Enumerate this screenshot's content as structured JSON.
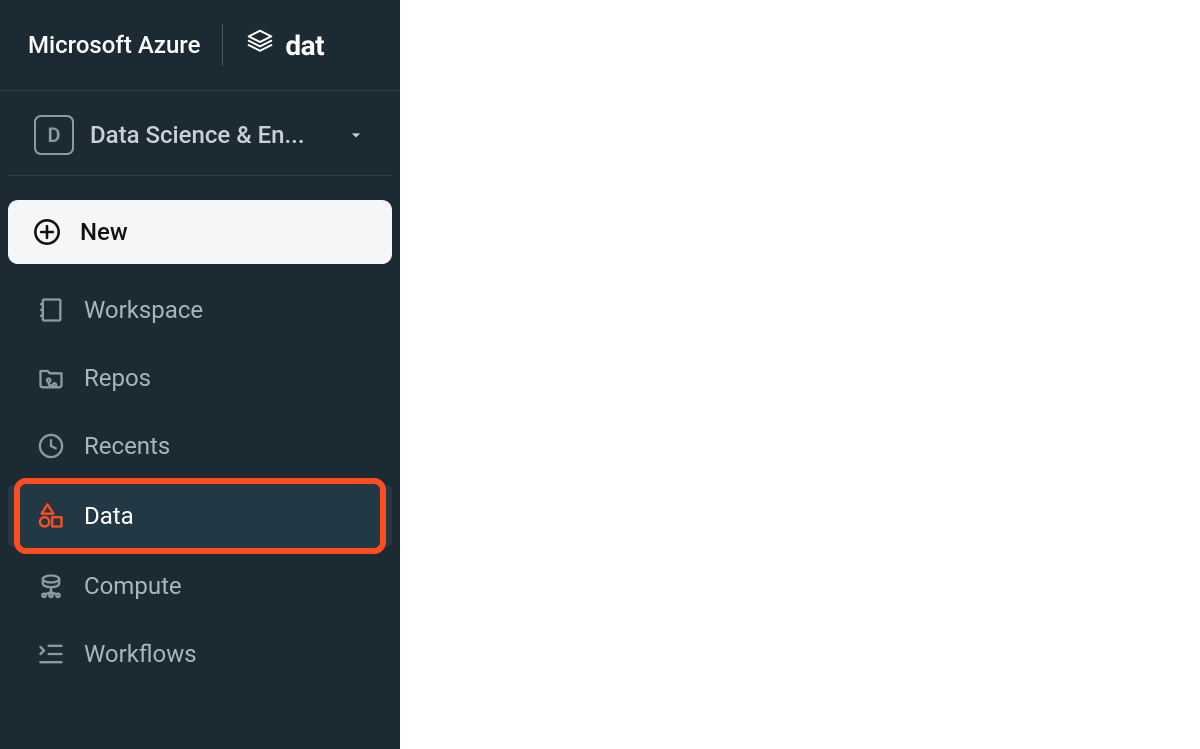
{
  "header": {
    "azure_label": "Microsoft Azure",
    "brand_partial": "dat"
  },
  "persona": {
    "badge_letter": "D",
    "label": "Data Science & En..."
  },
  "nav": {
    "new_label": "New",
    "items": [
      {
        "label": "Workspace"
      },
      {
        "label": "Repos"
      },
      {
        "label": "Recents"
      },
      {
        "label": "Data"
      },
      {
        "label": "Compute"
      },
      {
        "label": "Workflows"
      }
    ]
  }
}
